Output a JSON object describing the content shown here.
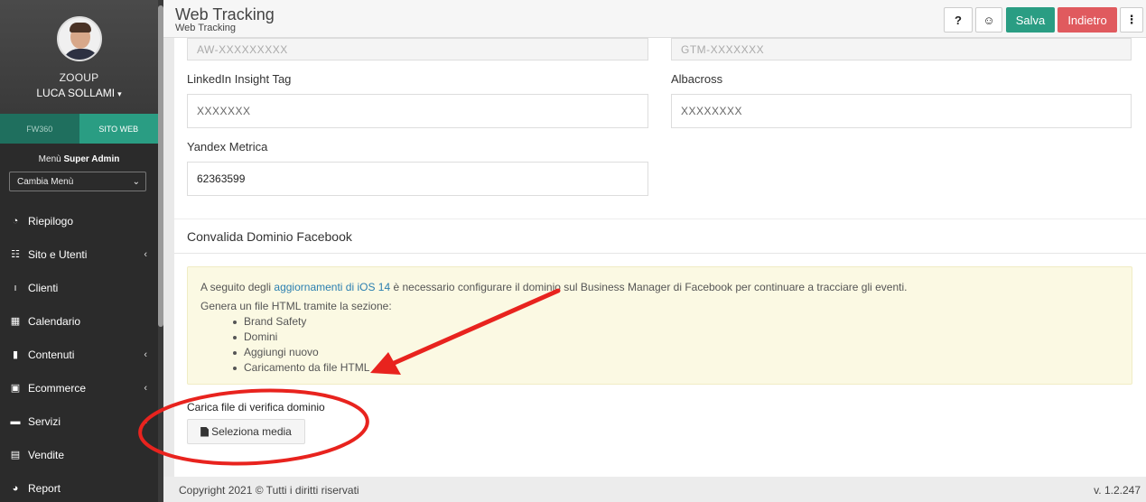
{
  "sidebar": {
    "org": "ZOOUP",
    "user": "LUCA SOLLAMI",
    "tabs": [
      "FW360",
      "SITO WEB"
    ],
    "menu_title_prefix": "Menù",
    "menu_title_bold": "Super Admin",
    "menu_select_value": "Cambia Menù",
    "items": [
      {
        "label": "Riepilogo",
        "icon": "gauge-icon"
      },
      {
        "label": "Sito e Utenti",
        "icon": "sitemap-icon",
        "has_submenu": true
      },
      {
        "label": "Clienti",
        "icon": "person-icon"
      },
      {
        "label": "Calendario",
        "icon": "calendar-icon"
      },
      {
        "label": "Contenuti",
        "icon": "file-icon",
        "has_submenu": true
      },
      {
        "label": "Ecommerce",
        "icon": "money-icon",
        "has_submenu": true
      },
      {
        "label": "Servizi",
        "icon": "briefcase-icon",
        "has_submenu": true
      },
      {
        "label": "Vendite",
        "icon": "calculator-icon"
      },
      {
        "label": "Report",
        "icon": "pie-chart-icon"
      }
    ]
  },
  "header": {
    "title": "Web Tracking",
    "subtitle": "Web Tracking",
    "help_label": "?",
    "save_label": "Salva",
    "back_label": "Indietro"
  },
  "form": {
    "google_ads_placeholder": "AW-XXXXXXXXX",
    "gtm_placeholder": "GTM-XXXXXXX",
    "linkedin_label": "LinkedIn Insight Tag",
    "linkedin_placeholder": "XXXXXXX",
    "albacross_label": "Albacross",
    "albacross_placeholder": "XXXXXXXX",
    "yandex_label": "Yandex Metrica",
    "yandex_value": "62363599"
  },
  "facebook": {
    "section_title": "Convalida Dominio Facebook",
    "notice_pre": "A seguito degli ",
    "notice_link": "aggiornamenti di iOS 14",
    "notice_post": " è necessario configurare il dominio sul Business Manager di Facebook per continuare a tracciare gli eventi.",
    "notice_intro": "Genera un file HTML tramite la sezione:",
    "steps": [
      "Brand Safety",
      "Domini",
      "Aggiungi nuovo",
      "Caricamento da file HTML"
    ],
    "upload_label": "Carica file di verifica dominio",
    "upload_button": "Seleziona media"
  },
  "footer": {
    "copyright": "Copyright 2021 © Tutti i diritti riservati",
    "version": "v. 1.2.247"
  },
  "colors": {
    "accent": "#2a9d83",
    "danger": "#e05a5e",
    "annotation": "#e8231e"
  }
}
